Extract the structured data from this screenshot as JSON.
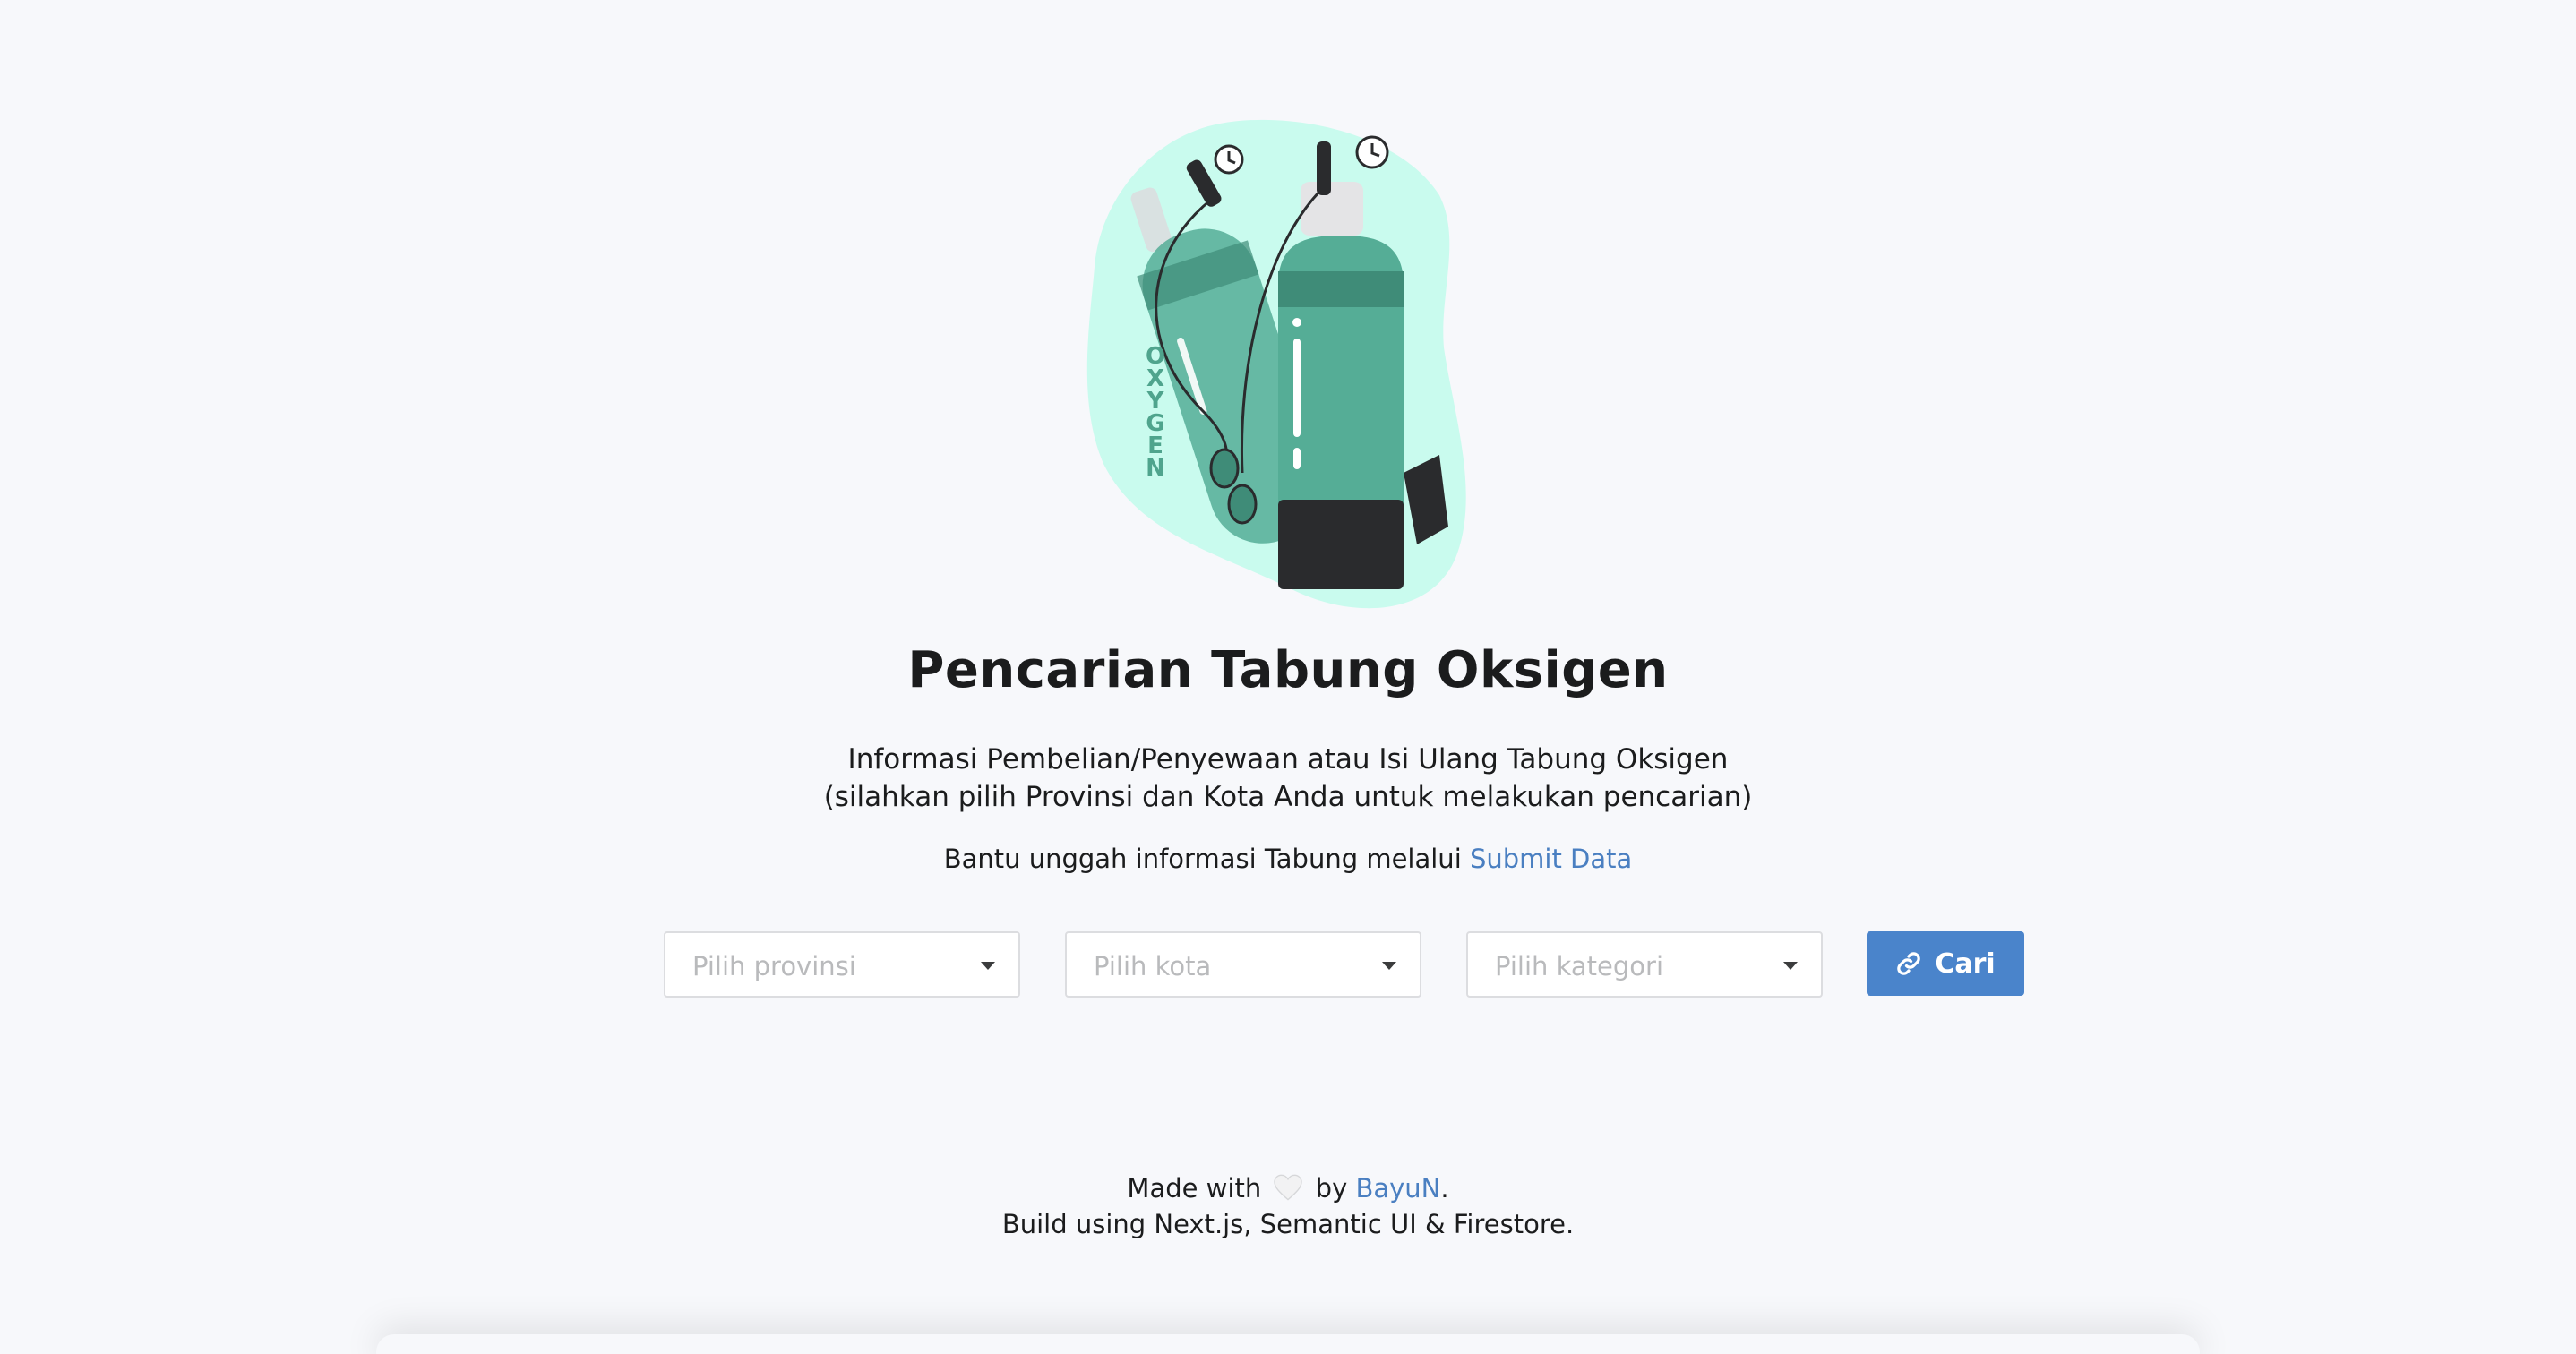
{
  "hero": {
    "image_name": "oxygen-tank-illustration",
    "tank_label": "OXYGEN",
    "colors": {
      "blob": "#c9fbee",
      "tank": "#55ad96",
      "tank_dark": "#3f8c78",
      "base": "#2a2b2d"
    }
  },
  "header": {
    "title": "Pencarian Tabung Oksigen",
    "subtitle_line1": "Informasi Pembelian/Penyewaan atau Isi Ulang Tabung Oksigen",
    "subtitle_line2": "(silahkan pilih Provinsi dan Kota Anda untuk melakukan pencarian)"
  },
  "contribute": {
    "text": "Bantu unggah informasi Tabung melalui",
    "link_label": "Submit Data"
  },
  "filters": {
    "provinsi_placeholder": "Pilih provinsi",
    "kota_placeholder": "Pilih kota",
    "kategori_placeholder": "Pilih kategori"
  },
  "search": {
    "button_label": "Cari",
    "icon": "link-icon"
  },
  "footer": {
    "made_with": "Made with",
    "by": "by",
    "author": "BayuN",
    "period": ".",
    "tech_line": "Build using Next.js, Semantic UI & Firestore."
  },
  "colors": {
    "accent": "#4a84cb",
    "link": "#4a7fc1",
    "background": "#f7f8fb"
  }
}
